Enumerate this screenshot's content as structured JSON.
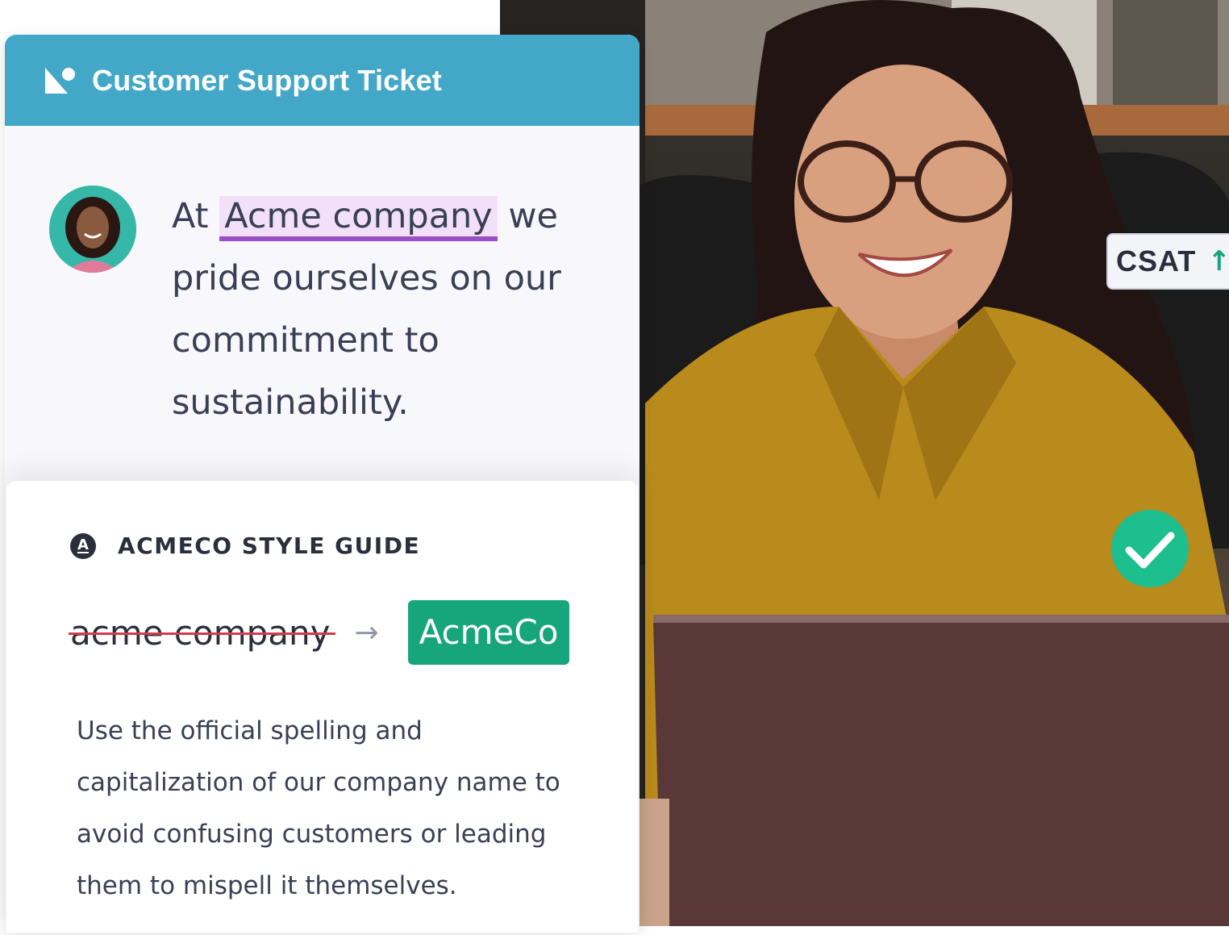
{
  "ticket": {
    "title": "Customer Support Ticket",
    "message": {
      "before": "At ",
      "highlight": "Acme company",
      "after": " we pride ourselves on our commitment to sustainability."
    }
  },
  "style_guide": {
    "icon_letter": "A",
    "title": "ACMECO STYLE GUIDE",
    "incorrect_term": "acme company",
    "arrow": "→",
    "correct_term": "AcmeCo",
    "description": "Use the official spelling and capitalization of our company name to avoid confusing customers or leading them to mispell it themselves."
  },
  "badges": {
    "csat_label": "CSAT",
    "csat_arrow": "↑"
  },
  "icons": {
    "logo": "brand-logo-icon",
    "check": "checkmark-icon",
    "style_guide": "style-guide-icon",
    "avatar": "user-avatar"
  },
  "colors": {
    "header": "#43a8c8",
    "highlight_bg": "#f1e0f7",
    "highlight_underline": "#9b4fc6",
    "strikethrough": "#d63a4a",
    "correct_term_bg": "#17a57c",
    "check_bg": "#1dbf8e"
  }
}
